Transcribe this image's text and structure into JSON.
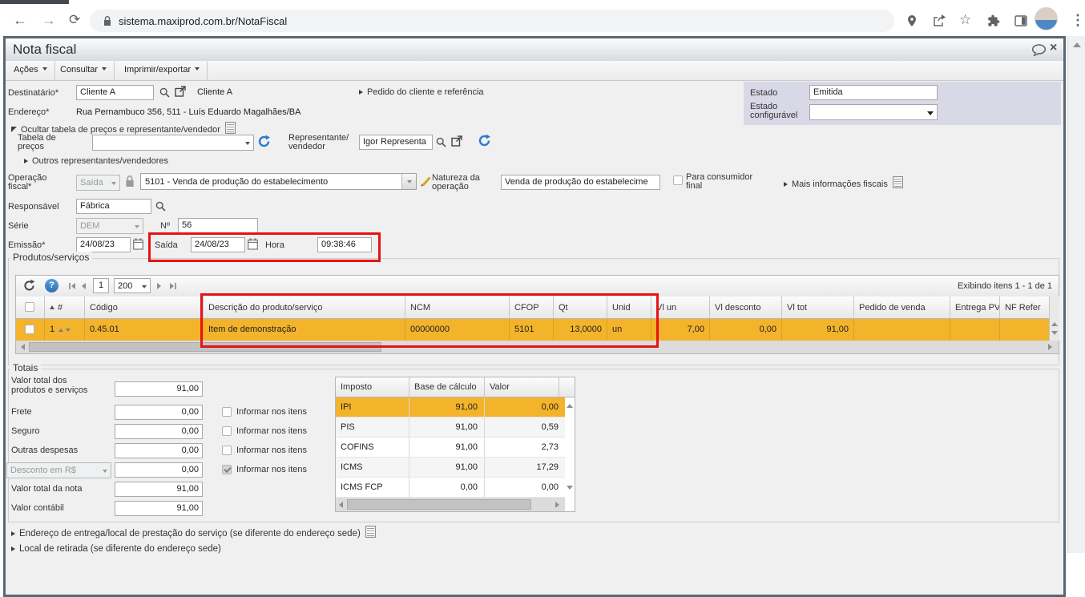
{
  "browser": {
    "url": "sistema.maxiprod.com.br/NotaFiscal"
  },
  "window": {
    "title": "Nota fiscal"
  },
  "menubar": {
    "acoes": "Ações",
    "consultar": "Consultar",
    "imprimir": "Imprimir/exportar"
  },
  "icons": {
    "back": "←",
    "forward": "→",
    "reload": "⟳",
    "bookmark_star": "☆",
    "menu_dots": "⋮",
    "close": "×",
    "help": "?",
    "search": "svg-magnifier",
    "external_link": "svg-box-arrow",
    "refresh": "svg-circular-arrow",
    "lock": "svg-padlock",
    "pencil": "svg-pencil",
    "calendar": "svg-calendar",
    "doc_note": "css-lined-box",
    "chat_bubble": "svg-speech-bubble",
    "location_pin": "svg-pin",
    "share": "svg-share",
    "extensions": "svg-puzzle",
    "side_panel": "svg-panel",
    "profile_avatar": "css-circle",
    "caret": "css-triangle-down",
    "expander_collapsed": "css-triangle-right",
    "expander_expanded": "css-triangle-corner",
    "sort_asc": "css-triangle-up"
  },
  "form": {
    "destinatario_label": "Destinatário*",
    "destinatario_value": "Cliente A",
    "destinatario_link": "Cliente A",
    "pedido_cliente_link": "Pedido do cliente e referência",
    "endereco_label": "Endereço*",
    "endereco_value": "Rua Pernambuco 356, 511 - Luís Eduardo Magalhães/BA",
    "ocultar_link": "Ocultar tabela de preços e representante/vendedor",
    "tabela_label": [
      "Tabela de",
      "preços"
    ],
    "representante_label": [
      "Representante/",
      "vendedor"
    ],
    "representante_value": "Igor Representa",
    "outros_link": "Outros representantes/vendedores",
    "operacao_label": [
      "Operação",
      "fiscal*"
    ],
    "operacao_tipo": "Saída",
    "operacao_cfop": "5101 - Venda de produção do estabelecimento",
    "natureza_label": [
      "Natureza da",
      "operação"
    ],
    "natureza_value": "Venda de produção do estabelecime",
    "consumidor_label": [
      "Para consumidor",
      "final"
    ],
    "mais_info_link": "Mais informações fiscais",
    "responsavel_label": "Responsável",
    "responsavel_value": "Fábrica",
    "serie_label": "Série",
    "serie_value": "DEM",
    "numero_label": "Nº",
    "numero_value": "56",
    "emissao_label": "Emissão*",
    "emissao_value": "24/08/23",
    "saida_label": "Saída",
    "saida_value": "24/08/23",
    "hora_label": "Hora",
    "hora_value": "09:38:46",
    "estado_label": "Estado",
    "estado_value": "Emitida",
    "estado_conf_label": [
      "Estado",
      "configurável"
    ]
  },
  "products": {
    "section_title": "Produtos/serviços",
    "page": "1",
    "page_size": "200",
    "showing": "Exibindo itens 1 - 1 de 1",
    "headers": {
      "num": "#",
      "codigo": "Código",
      "descricao": "Descrição do produto/serviço",
      "ncm": "NCM",
      "cfop": "CFOP",
      "qt": "Qt",
      "unid": "Unid",
      "vl_un": "Vl un",
      "vl_desconto": "Vl desconto",
      "vl_tot": "Vl tot",
      "pedido": "Pedido de venda",
      "entrega": "Entrega PV",
      "nf_refer": "NF Refer"
    },
    "row": {
      "num": "1",
      "codigo": "0.45.01",
      "descricao": "Item de demonstração",
      "ncm": "00000000",
      "cfop": "5101",
      "qt": "13,0000",
      "unid": "un",
      "vl_un": "7,00",
      "vl_desconto": "0,00",
      "vl_tot": "91,00"
    }
  },
  "totals": {
    "section_title": "Totais",
    "valor_total_label": [
      "Valor total dos",
      "produtos e serviços"
    ],
    "valor_total": "91,00",
    "frete_label": "Frete",
    "frete": "0,00",
    "seguro_label": "Seguro",
    "seguro": "0,00",
    "outras_label": "Outras despesas",
    "outras": "0,00",
    "desconto_label": "Desconto em R$",
    "desconto": "0,00",
    "informar": "Informar nos itens",
    "nota_label": "Valor total da nota",
    "nota": "91,00",
    "contabil_label": "Valor contábil",
    "contabil": "91,00"
  },
  "tax": {
    "headers": [
      "Imposto",
      "Base de cálculo",
      "Valor"
    ],
    "rows": [
      [
        "IPI",
        "91,00",
        "0,00"
      ],
      [
        "PIS",
        "91,00",
        "0,59"
      ],
      [
        "COFINS",
        "91,00",
        "2,73"
      ],
      [
        "ICMS",
        "91,00",
        "17,29"
      ],
      [
        "ICMS FCP",
        "0,00",
        "0,00"
      ]
    ]
  },
  "footer": {
    "entrega_link": "Endereço de entrega/local de prestação do serviço (se diferente do endereço sede)",
    "retirada_link": "Local de retirada (se diferente do endereço sede)"
  },
  "colors": {
    "accent_blue": "#2a7ad0",
    "selected_row": "#f3b32a",
    "annotation_red": "#e81212",
    "estado_panel": "#d9d8e6"
  }
}
